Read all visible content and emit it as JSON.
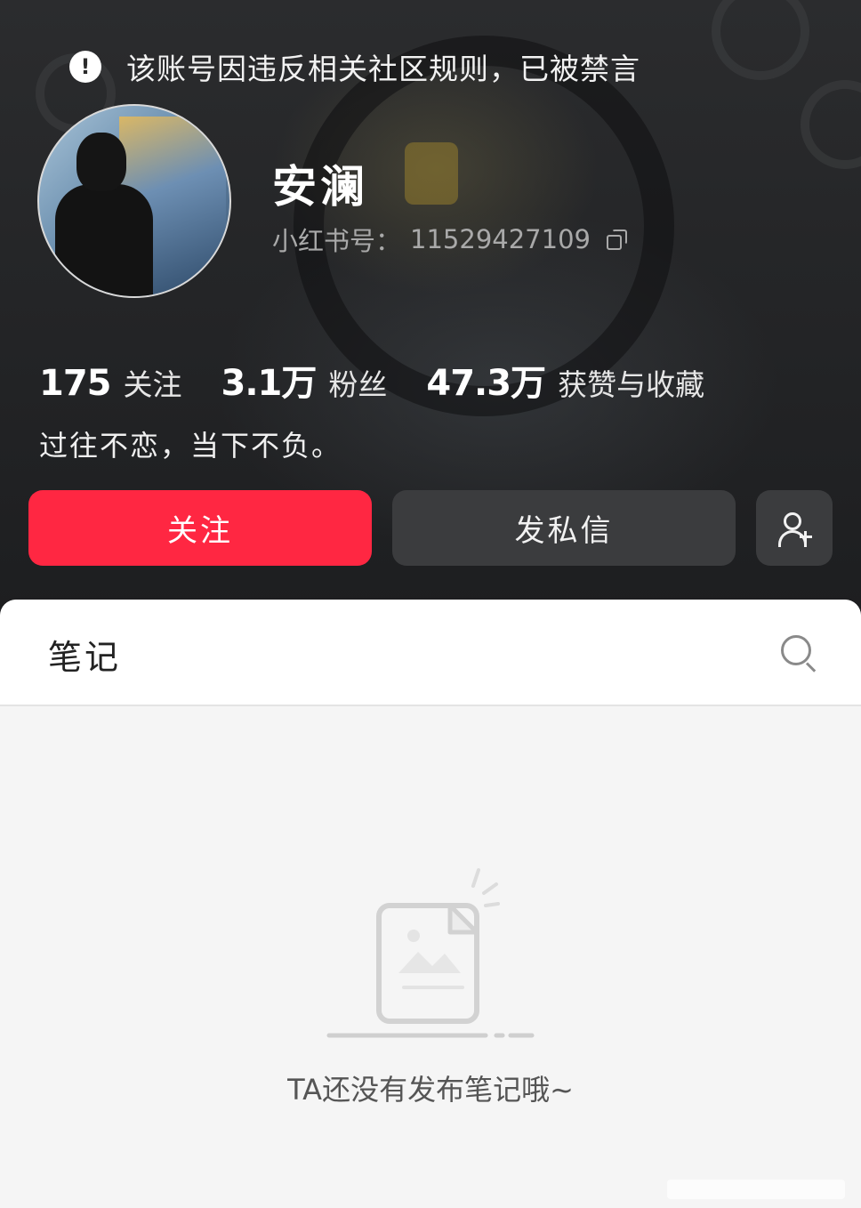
{
  "notice": {
    "icon": "exclamation-circle-icon",
    "text": "该账号因违反相关社区规则，已被禁言"
  },
  "profile": {
    "name": "安澜",
    "id_label": "小红书号：",
    "id_value": "11529427109",
    "bio": "过往不恋，当下不负。"
  },
  "stats": [
    {
      "value": "175",
      "label": "关注"
    },
    {
      "value": "3.1万",
      "label": "粉丝"
    },
    {
      "value": "47.3万",
      "label": "获赞与收藏"
    }
  ],
  "actions": {
    "follow": "关注",
    "message": "发私信",
    "add_friend_icon": "add-user-icon"
  },
  "tabs": {
    "notes": "笔记",
    "search_icon": "search-icon"
  },
  "empty_state": {
    "icon": "empty-document-icon",
    "text": "TA还没有发布笔记哦~"
  },
  "colors": {
    "accent": "#ff2742",
    "header_bg": "#252628",
    "button_dark": "#3b3c3e"
  }
}
